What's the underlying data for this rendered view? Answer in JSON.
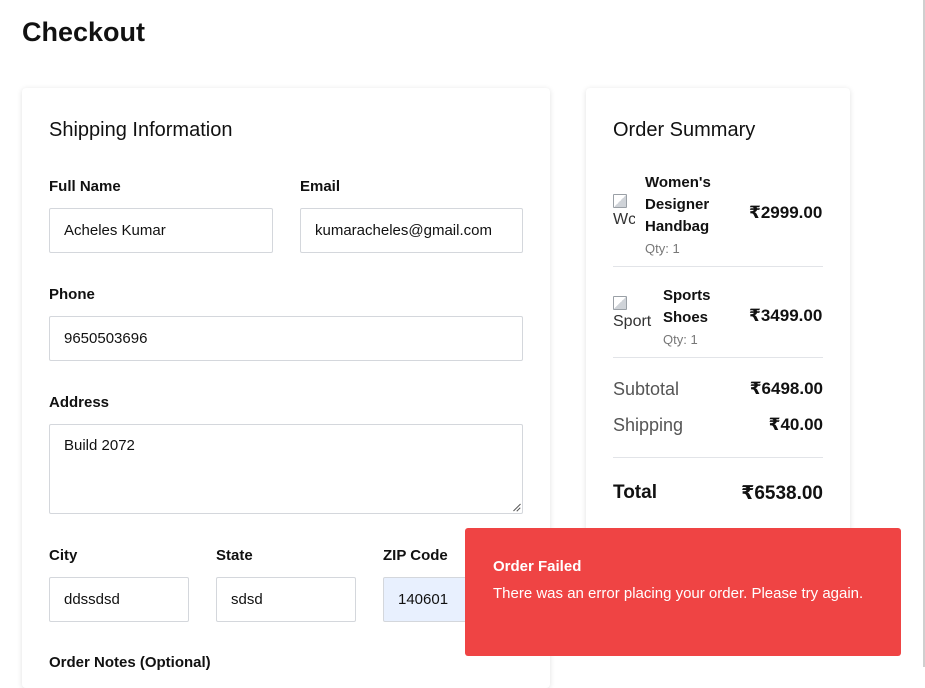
{
  "page": {
    "title": "Checkout"
  },
  "shipping": {
    "title": "Shipping Information",
    "full_name": {
      "label": "Full Name",
      "value": "Acheles Kumar"
    },
    "email": {
      "label": "Email",
      "value": "kumaracheles@gmail.com"
    },
    "phone": {
      "label": "Phone",
      "value": "9650503696"
    },
    "address": {
      "label": "Address",
      "value": "Build 2072"
    },
    "city": {
      "label": "City",
      "value": "ddssdsd"
    },
    "state": {
      "label": "State",
      "value": "sdsd"
    },
    "zip": {
      "label": "ZIP Code",
      "value": "140601"
    },
    "notes": {
      "label": "Order Notes (Optional)"
    }
  },
  "summary": {
    "title": "Order Summary",
    "items": [
      {
        "name_lines": [
          "Women's",
          "Designer",
          "Handbag"
        ],
        "img_alt": "Wc",
        "qty": "Qty: 1",
        "price": "₹2999.00"
      },
      {
        "name_lines": [
          "Sports",
          "Shoes"
        ],
        "img_alt": "Sport",
        "qty": "Qty: 1",
        "price": "₹3499.00"
      }
    ],
    "subtotal_label": "Subtotal",
    "subtotal_value": "₹6498.00",
    "shipping_label": "Shipping",
    "shipping_value": "₹40.00",
    "total_label": "Total",
    "total_value": "₹6538.00"
  },
  "toast": {
    "title": "Order Failed",
    "message": "There was an error placing your order. Please try again.",
    "color": "#ef4444"
  }
}
